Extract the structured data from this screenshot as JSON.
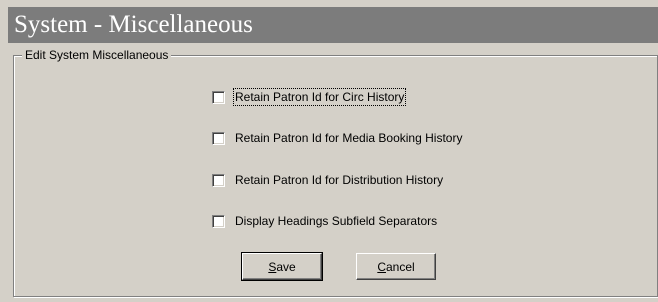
{
  "window": {
    "title": "System - Miscellaneous"
  },
  "group": {
    "legend": "Edit System Miscellaneous"
  },
  "options": [
    {
      "label": "Retain Patron Id for Circ History",
      "checked": false
    },
    {
      "label": "Retain Patron Id for Media Booking History",
      "checked": false
    },
    {
      "label": "Retain Patron Id for Distribution History",
      "checked": false
    },
    {
      "label": "Display Headings Subfield Separators",
      "checked": false
    }
  ],
  "buttons": {
    "save": {
      "accel": "S",
      "rest": "ave"
    },
    "cancel": {
      "accel": "C",
      "rest": "ancel"
    }
  },
  "colors": {
    "face": "#d4d0c8",
    "titlebar": "#7c7c7c",
    "title_text": "#ffffff"
  }
}
